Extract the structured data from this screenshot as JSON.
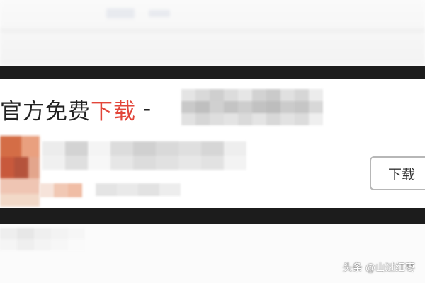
{
  "listing": {
    "title_prefix": "官方免费",
    "title_highlight": "下载",
    "title_separator": "-",
    "download_button_label": "下载"
  },
  "watermark": {
    "text": "头条 @山过红枣"
  },
  "colors": {
    "highlight": "#e2463a",
    "frame": "#1c1c1c",
    "button_border": "#b7b7b7"
  }
}
